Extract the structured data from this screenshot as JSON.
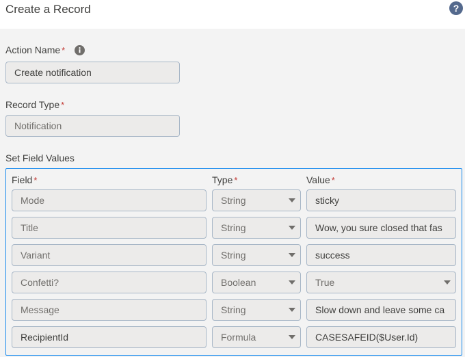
{
  "header": {
    "title": "Create a Record",
    "help_icon": "question-circle-icon"
  },
  "action_name": {
    "label": "Action Name",
    "required": "*",
    "value": "Create notification",
    "info_icon": "info-icon"
  },
  "record_type": {
    "label": "Record Type",
    "required": "*",
    "value": "Notification"
  },
  "field_values": {
    "label": "Set Field Values",
    "columns": {
      "field": "Field",
      "type": "Type",
      "value": "Value",
      "required": "*"
    },
    "rows": [
      {
        "field": "Mode",
        "type": "String",
        "value": "sticky"
      },
      {
        "field": "Title",
        "type": "String",
        "value": "Wow, you sure closed that fas"
      },
      {
        "field": "Variant",
        "type": "String",
        "value": "success"
      },
      {
        "field": "Confetti?",
        "type": "Boolean",
        "value": "True"
      },
      {
        "field": "Message",
        "type": "String",
        "value": "Slow down and leave some ca"
      },
      {
        "field": "RecipientId",
        "type": "Formula",
        "value": "CASESAFEID($User.Id)"
      }
    ]
  },
  "colors": {
    "focus_border": "#1589ee",
    "required": "#c23934",
    "field_bg": "#ecebea"
  }
}
